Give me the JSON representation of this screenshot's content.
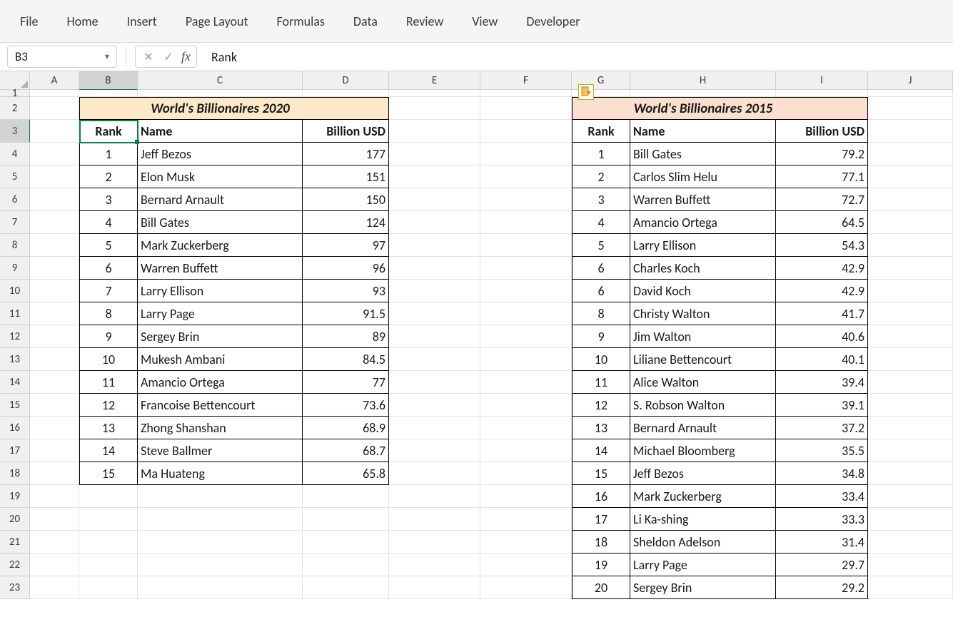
{
  "ribbon": {
    "tabs": [
      "File",
      "Home",
      "Insert",
      "Page Layout",
      "Formulas",
      "Data",
      "Review",
      "View",
      "Developer"
    ]
  },
  "namebox": {
    "value": "B3"
  },
  "formula_bar": {
    "value": "Rank",
    "fx_label": "fx"
  },
  "columns": [
    "A",
    "B",
    "C",
    "D",
    "E",
    "F",
    "G",
    "H",
    "I",
    "J"
  ],
  "row_labels": [
    "1",
    "2",
    "3",
    "4",
    "5",
    "6",
    "7",
    "8",
    "9",
    "10",
    "11",
    "12",
    "13",
    "14",
    "15",
    "16",
    "17",
    "18",
    "19",
    "20",
    "21",
    "22",
    "23"
  ],
  "table_2020": {
    "title": "World's Billionaires 2020",
    "headers": {
      "rank": "Rank",
      "name": "Name",
      "billion": "Billion USD"
    },
    "rows": [
      {
        "rank": "1",
        "name": "Jeff Bezos",
        "value": "177"
      },
      {
        "rank": "2",
        "name": "Elon Musk",
        "value": "151"
      },
      {
        "rank": "3",
        "name": "Bernard Arnault",
        "value": "150"
      },
      {
        "rank": "4",
        "name": "Bill Gates",
        "value": "124"
      },
      {
        "rank": "5",
        "name": "Mark Zuckerberg",
        "value": "97"
      },
      {
        "rank": "6",
        "name": "Warren Buffett",
        "value": "96"
      },
      {
        "rank": "7",
        "name": "Larry Ellison",
        "value": "93"
      },
      {
        "rank": "8",
        "name": "Larry Page",
        "value": "91.5"
      },
      {
        "rank": "9",
        "name": "Sergey Brin",
        "value": "89"
      },
      {
        "rank": "10",
        "name": "Mukesh Ambani",
        "value": "84.5"
      },
      {
        "rank": "11",
        "name": "Amancio Ortega",
        "value": "77"
      },
      {
        "rank": "12",
        "name": "Francoise Bettencourt",
        "value": "73.6"
      },
      {
        "rank": "13",
        "name": "Zhong Shanshan",
        "value": "68.9"
      },
      {
        "rank": "14",
        "name": "Steve Ballmer",
        "value": "68.7"
      },
      {
        "rank": "15",
        "name": "Ma Huateng",
        "value": "65.8"
      }
    ]
  },
  "table_2015": {
    "title": "World's Billionaires 2015",
    "headers": {
      "rank": "Rank",
      "name": "Name",
      "billion": "Billion USD"
    },
    "rows": [
      {
        "rank": "1",
        "name": "Bill Gates",
        "value": "79.2"
      },
      {
        "rank": "2",
        "name": "Carlos Slim Helu",
        "value": "77.1"
      },
      {
        "rank": "3",
        "name": "Warren Buffett",
        "value": "72.7"
      },
      {
        "rank": "4",
        "name": "Amancio Ortega",
        "value": "64.5"
      },
      {
        "rank": "5",
        "name": "Larry Ellison",
        "value": "54.3"
      },
      {
        "rank": "6",
        "name": "Charles Koch",
        "value": "42.9"
      },
      {
        "rank": "6",
        "name": "David Koch",
        "value": "42.9"
      },
      {
        "rank": "8",
        "name": "Christy Walton",
        "value": "41.7"
      },
      {
        "rank": "9",
        "name": "Jim Walton",
        "value": "40.6"
      },
      {
        "rank": "10",
        "name": "Liliane Bettencourt",
        "value": "40.1"
      },
      {
        "rank": "11",
        "name": "Alice Walton",
        "value": "39.4"
      },
      {
        "rank": "12",
        "name": "S. Robson Walton",
        "value": "39.1"
      },
      {
        "rank": "13",
        "name": "Bernard Arnault",
        "value": "37.2"
      },
      {
        "rank": "14",
        "name": "Michael Bloomberg",
        "value": "35.5"
      },
      {
        "rank": "15",
        "name": "Jeff Bezos",
        "value": "34.8"
      },
      {
        "rank": "16",
        "name": "Mark Zuckerberg",
        "value": "33.4"
      },
      {
        "rank": "17",
        "name": "Li Ka-shing",
        "value": "33.3"
      },
      {
        "rank": "18",
        "name": "Sheldon Adelson",
        "value": "31.4"
      },
      {
        "rank": "19",
        "name": "Larry Page",
        "value": "29.7"
      },
      {
        "rank": "20",
        "name": "Sergey Brin",
        "value": "29.2"
      }
    ]
  },
  "icons": {
    "paste_options": "paste-options-icon"
  }
}
